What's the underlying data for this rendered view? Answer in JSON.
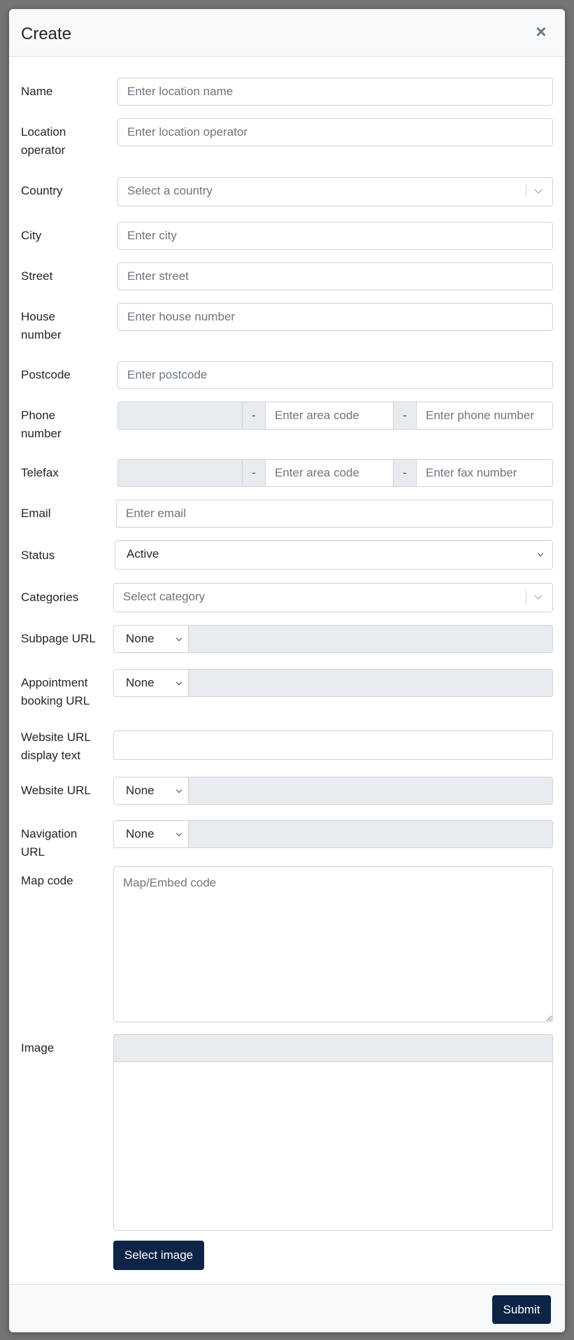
{
  "dialog": {
    "title": "Create",
    "close_glyph": "×"
  },
  "fields": {
    "name": {
      "label": "Name",
      "placeholder": "Enter location name"
    },
    "location_operator": {
      "label": "Location operator",
      "placeholder": "Enter location operator"
    },
    "country": {
      "label": "Country",
      "placeholder": "Select a country"
    },
    "city": {
      "label": "City",
      "placeholder": "Enter city"
    },
    "street": {
      "label": "Street",
      "placeholder": "Enter street"
    },
    "house_number": {
      "label": "House number",
      "placeholder": "Enter house number"
    },
    "postcode": {
      "label": "Postcode",
      "placeholder": "Enter postcode"
    },
    "phone_number": {
      "label": "Phone number",
      "separator": "-",
      "area_placeholder": "Enter area code",
      "number_placeholder": "Enter phone number"
    },
    "telefax": {
      "label": "Telefax",
      "separator": "-",
      "area_placeholder": "Enter area code",
      "number_placeholder": "Enter fax number"
    },
    "email": {
      "label": "Email",
      "placeholder": "Enter email"
    },
    "status": {
      "label": "Status",
      "value": "Active"
    },
    "categories": {
      "label": "Categories",
      "placeholder": "Select category"
    },
    "subpage_url": {
      "label": "Subpage URL",
      "value": "None"
    },
    "appointment_booking_url": {
      "label": "Appointment booking URL",
      "value": "None"
    },
    "website_url_display_text": {
      "label": "Website URL display text"
    },
    "website_url": {
      "label": "Website URL",
      "value": "None"
    },
    "navigation_url": {
      "label": "Navigation URL",
      "value": "None"
    },
    "map_code": {
      "label": "Map code",
      "placeholder": "Map/Embed code"
    },
    "image": {
      "label": "Image",
      "button": "Select image"
    }
  },
  "footer": {
    "submit_label": "Submit"
  },
  "colors": {
    "primary": "#0d2447",
    "addon_grey": "#e9ecef",
    "border": "#ced4da"
  }
}
